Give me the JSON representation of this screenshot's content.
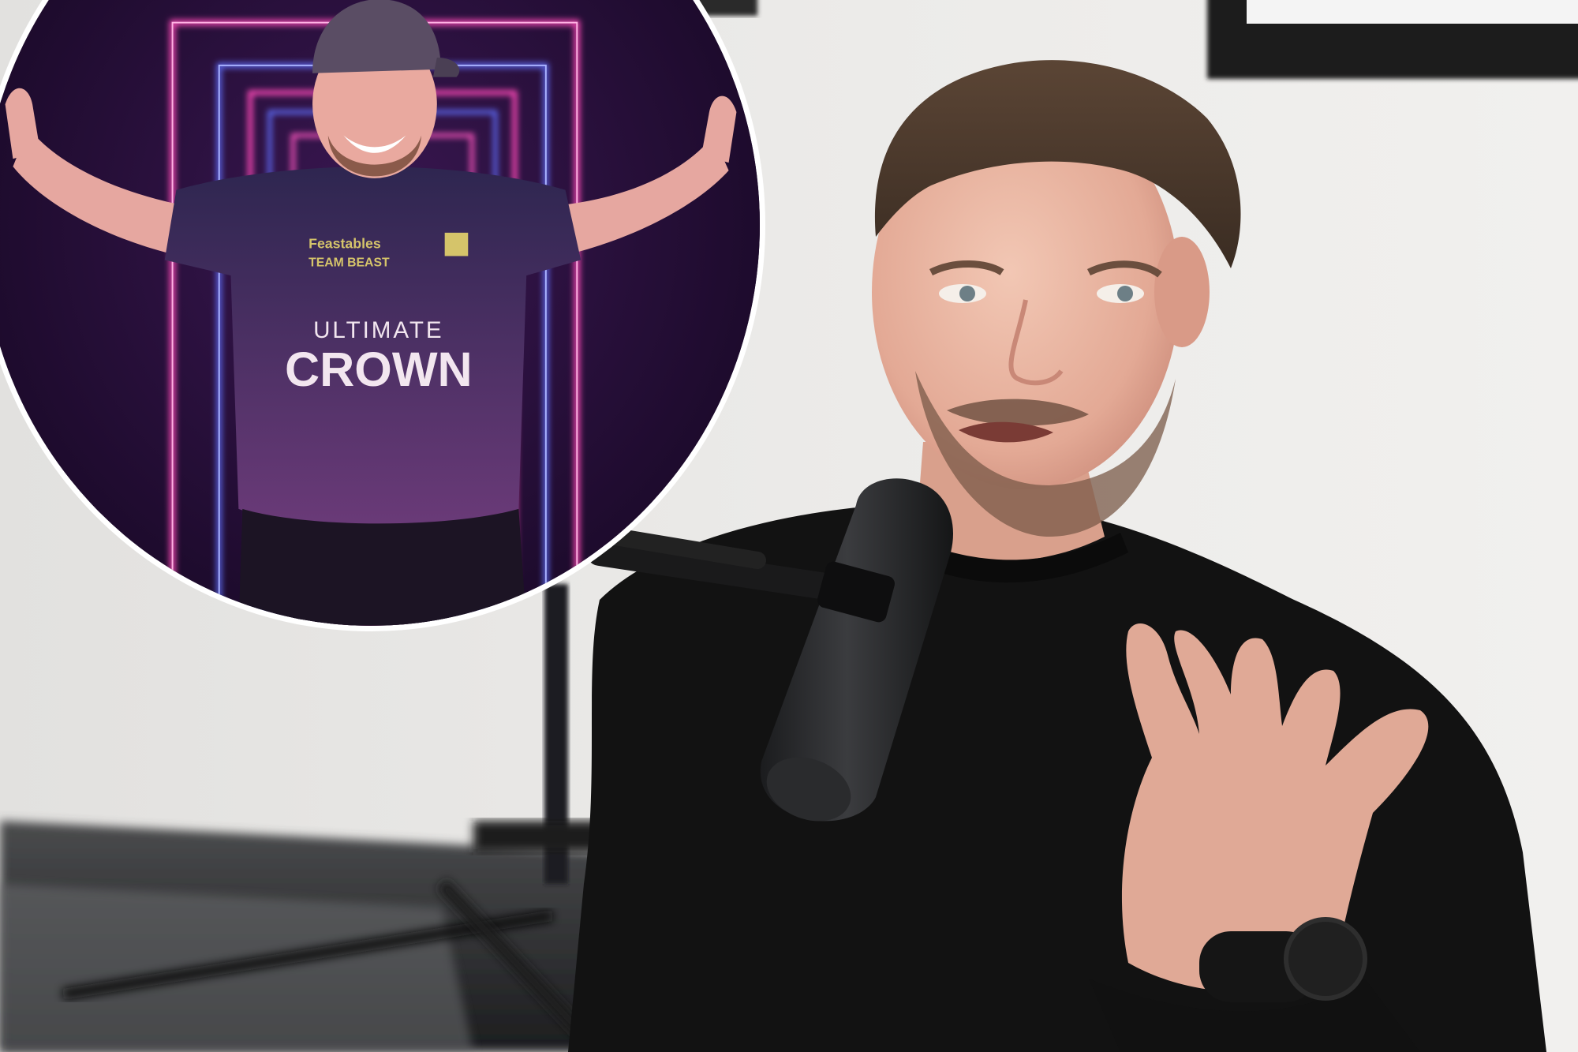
{
  "photo": {
    "jersey_sponsor_top": "Feastables",
    "jersey_team": "TEAM BEAST",
    "jersey_line_small": "ULTIMATE",
    "jersey_line_big": "CROWN"
  },
  "colors": {
    "wall": "#e9e8e6",
    "floor": "#2a2b2d",
    "shirt_black": "#121212",
    "neon_pink": "#ff3fae",
    "neon_blue": "#5b6bff",
    "jersey_purple": "#4e2f63",
    "jersey_text": "#f2e6ef",
    "inset_border": "#ffffff"
  }
}
